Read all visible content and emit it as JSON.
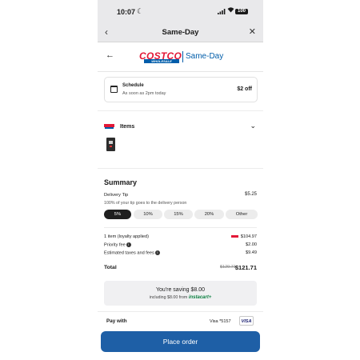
{
  "status_bar": {
    "time": "10:07",
    "battery": "100"
  },
  "nav": {
    "title": "Same-Day"
  },
  "brand": {
    "logo_word": "COSTCO",
    "logo_sub": "WHOLESALE",
    "service": "Same-Day"
  },
  "schedule": {
    "label": "Schedule",
    "subtitle": "As soon as 2pm today",
    "discount": "$2 off"
  },
  "items": {
    "label": "Items"
  },
  "summary": {
    "title": "Summary",
    "tip_label": "Delivery Tip",
    "tip_amount": "$5.25",
    "tip_note": "100% of your tip goes to the delivery person",
    "tip_options": [
      "5%",
      "10%",
      "15%",
      "20%",
      "Other"
    ],
    "tip_selected": "5%",
    "lines": [
      {
        "label": "1 item (loyalty applied)",
        "value": "$104.97"
      },
      {
        "label": "Priority fee",
        "value": "$2.00"
      },
      {
        "label": "Estimated taxes and fees",
        "value": "$9.49"
      }
    ],
    "total_label": "Total",
    "total_original": "$129.71",
    "total": "$121.71"
  },
  "savings": {
    "headline": "You're saving $8.00",
    "detail": "including $8.00 from",
    "source": "instacart+"
  },
  "payment": {
    "label": "Pay with",
    "card": "Visa *5157",
    "card_brand": "VISA"
  },
  "cta": {
    "label": "Place order"
  },
  "colors": {
    "costco_red": "#e31837",
    "costco_blue": "#005daa",
    "cta_blue": "#1e5fa6",
    "instacart_green": "#0a7f3f"
  }
}
